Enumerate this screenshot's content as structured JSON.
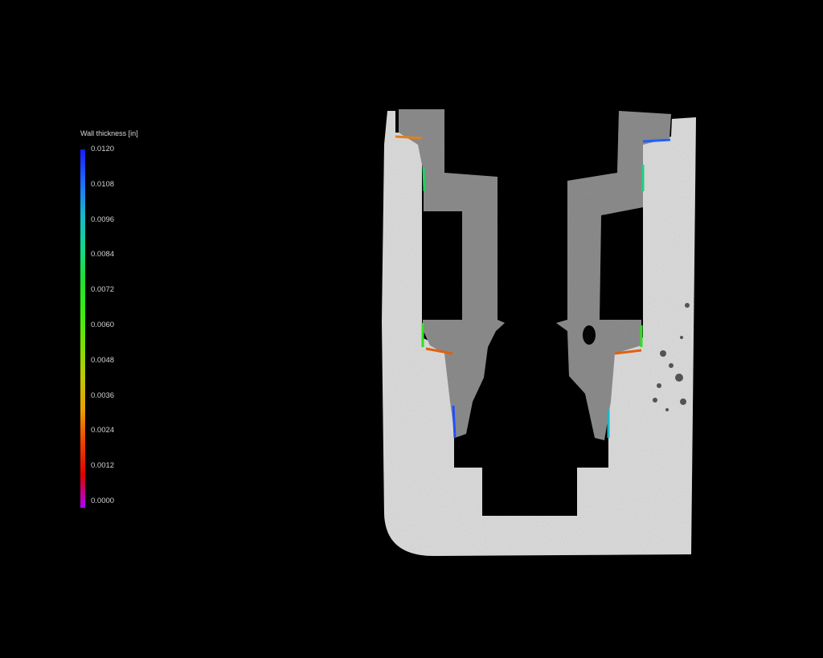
{
  "legend": {
    "title": "Wall thickness [in]",
    "ticks": [
      "0.0120",
      "0.0108",
      "0.0096",
      "0.0084",
      "0.0072",
      "0.0060",
      "0.0048",
      "0.0036",
      "0.0024",
      "0.0012",
      "0.0000"
    ],
    "colors": [
      "#1a1aff",
      "#1e6bff",
      "#17b7c9",
      "#10d890",
      "#20e030",
      "#38ee10",
      "#7ce000",
      "#c0c800",
      "#e8a000",
      "#f04000",
      "#e00000",
      "#b000ff"
    ]
  },
  "image": {
    "subject": "CT scan cross-section of a part with wall thickness analysis overlay",
    "background_color": "#000000",
    "part_color": "#dcdcdc",
    "inner_color": "#8c8c8c"
  }
}
